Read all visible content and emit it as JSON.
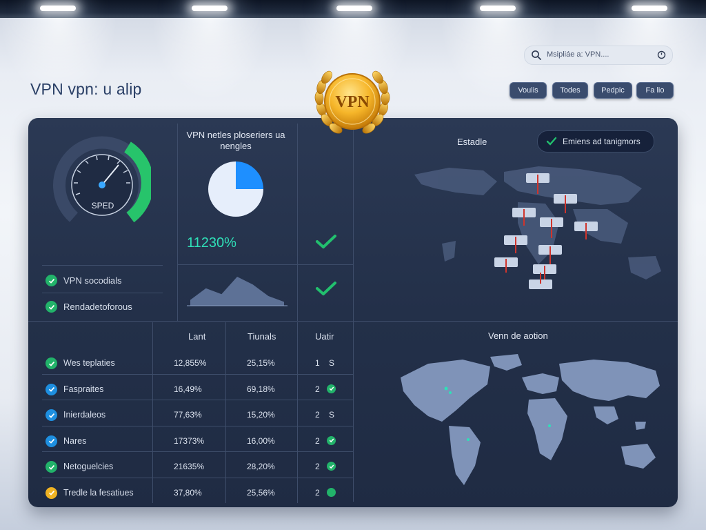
{
  "app": {
    "title": "VPN vpn: u alip",
    "badge_text": "VPN"
  },
  "search": {
    "text": "Msipliáe a: VPN....",
    "icons": [
      "search-icon",
      "clock-icon"
    ]
  },
  "tabs": [
    {
      "label": "Voulis"
    },
    {
      "label": "Todes"
    },
    {
      "label": "Pedpic"
    },
    {
      "label": "Fa lio"
    }
  ],
  "speed": {
    "label": "SPED",
    "gauge_level": 0.7,
    "colors": {
      "arc": "#27c46b",
      "needle": "#3aa8ff"
    }
  },
  "status_list": [
    {
      "label": "VPN socodials"
    },
    {
      "label": "Rendadetoforous"
    }
  ],
  "chart_card": {
    "title": "VPN netles ploseriers ua nengles",
    "percent": "11230%",
    "chart_data": [
      {
        "type": "pie",
        "values": [
          25,
          75
        ],
        "colors": [
          "#1e8fff",
          "#e6eefb"
        ]
      },
      {
        "type": "area",
        "values": [
          6,
          18,
          12,
          30,
          22,
          10,
          4
        ]
      }
    ]
  },
  "map_top": {
    "title": "Estadle",
    "status_pill": "Emiens ad tanigmors"
  },
  "table": {
    "headers": [
      "Lant",
      "Tiunals",
      "Uatir"
    ],
    "rows": [
      {
        "label": "Wes teplaties",
        "icon": "check-icon",
        "color": "#22b36a",
        "c1": "12,855%",
        "c2": "25,15%",
        "c3": "1",
        "flag": "S"
      },
      {
        "label": "Faspraites",
        "icon": "check-icon",
        "color": "#1e8fe0",
        "c1": "16,49%",
        "c2": "69,18%",
        "c3": "2",
        "flag": "check"
      },
      {
        "label": "Inierdaleos",
        "icon": "check-icon",
        "color": "#1e8fe0",
        "c1": "77,63%",
        "c2": "15,20%",
        "c3": "2",
        "flag": "S"
      },
      {
        "label": "Nares",
        "icon": "check-icon",
        "color": "#1e8fe0",
        "c1": "17373%",
        "c2": "16,00%",
        "c3": "2",
        "flag": "check"
      },
      {
        "label": "Netoguelcies",
        "icon": "check-icon",
        "color": "#22b36a",
        "c1": "21635%",
        "c2": "28,20%",
        "c3": "2",
        "flag": "check"
      },
      {
        "label": "Tredle la fesatiues",
        "icon": "check-icon",
        "color": "#f0b323",
        "c1": "37,80%",
        "c2": "25,56%",
        "c3": "2",
        "flag": "dot"
      }
    ]
  },
  "map_bottom": {
    "title": "Venn de aotion"
  }
}
